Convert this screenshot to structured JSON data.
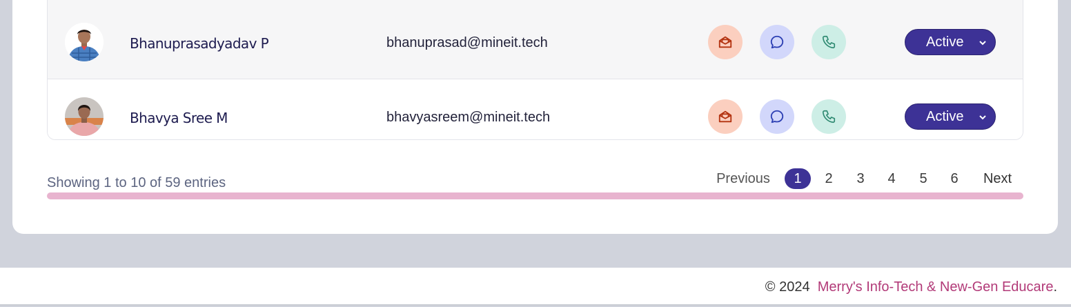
{
  "users": [
    {
      "name": "Bhanuprasadyadav P",
      "email": "bhanuprasad@mineit.tech",
      "status": "Active"
    },
    {
      "name": "Bhavya Sree M",
      "email": "bhavyasreem@mineit.tech",
      "status": "Active"
    }
  ],
  "icons": {
    "mail": "mail-open-icon",
    "chat": "chat-bubble-icon",
    "phone": "phone-icon",
    "dropdown": "chevron-down-icon"
  },
  "pagination": {
    "info": "Showing 1 to 10 of 59 entries",
    "previous": "Previous",
    "next": "Next",
    "pages": [
      "1",
      "2",
      "3",
      "4",
      "5",
      "6"
    ],
    "current": "1"
  },
  "footer": {
    "copyright": "© 2024",
    "company": "Merry's Info-Tech & New-Gen Educare",
    "period": "."
  },
  "colors": {
    "accent": "#3d3296",
    "mail_bg": "#fbcfbf",
    "chat_bg": "#d2d7fb",
    "phone_bg": "#cdeee6",
    "progress": "#e8b4cf",
    "brand": "#b23a78"
  }
}
